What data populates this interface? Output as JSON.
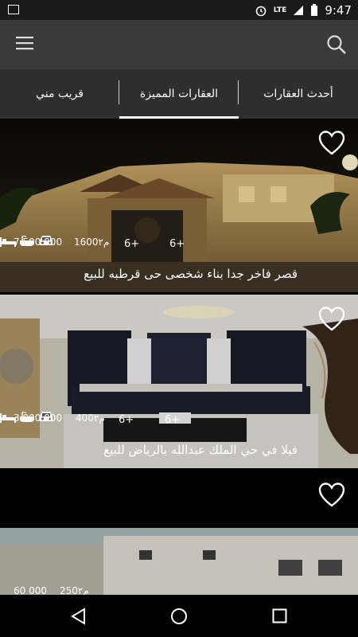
{
  "status_bar": {
    "time": "9:47",
    "network": "LTE"
  },
  "tabs": [
    {
      "label": "أحدث العقارات",
      "active": false
    },
    {
      "label": "العقارات المميزة",
      "active": true
    },
    {
      "label": "قريب مني",
      "active": false
    }
  ],
  "listings": [
    {
      "price": "7 500 000",
      "area": "1600م٢",
      "bedrooms": "6+",
      "bathrooms": "6+",
      "title": "قصر فاخر جدا بناء شخصى حى قرطبه للبيع"
    },
    {
      "price": "3 000 000",
      "area": "400م٢",
      "bedrooms": "6+",
      "bathrooms": "6+",
      "title": "فيلا في حي الملك عبدالله بالرياض للبيع"
    },
    {
      "price": "60 000",
      "area": "250م٢",
      "bedrooms": "",
      "bathrooms": "",
      "title": ""
    }
  ],
  "colors": {
    "appbar": "#3a3a3a",
    "tabs": "#2e2e2e",
    "accent": "#ffffff"
  },
  "icons": [
    "menu-icon",
    "search-icon",
    "heart-icon",
    "bed-icon",
    "bath-icon",
    "car-icon",
    "back-icon",
    "home-icon",
    "recents-icon"
  ]
}
